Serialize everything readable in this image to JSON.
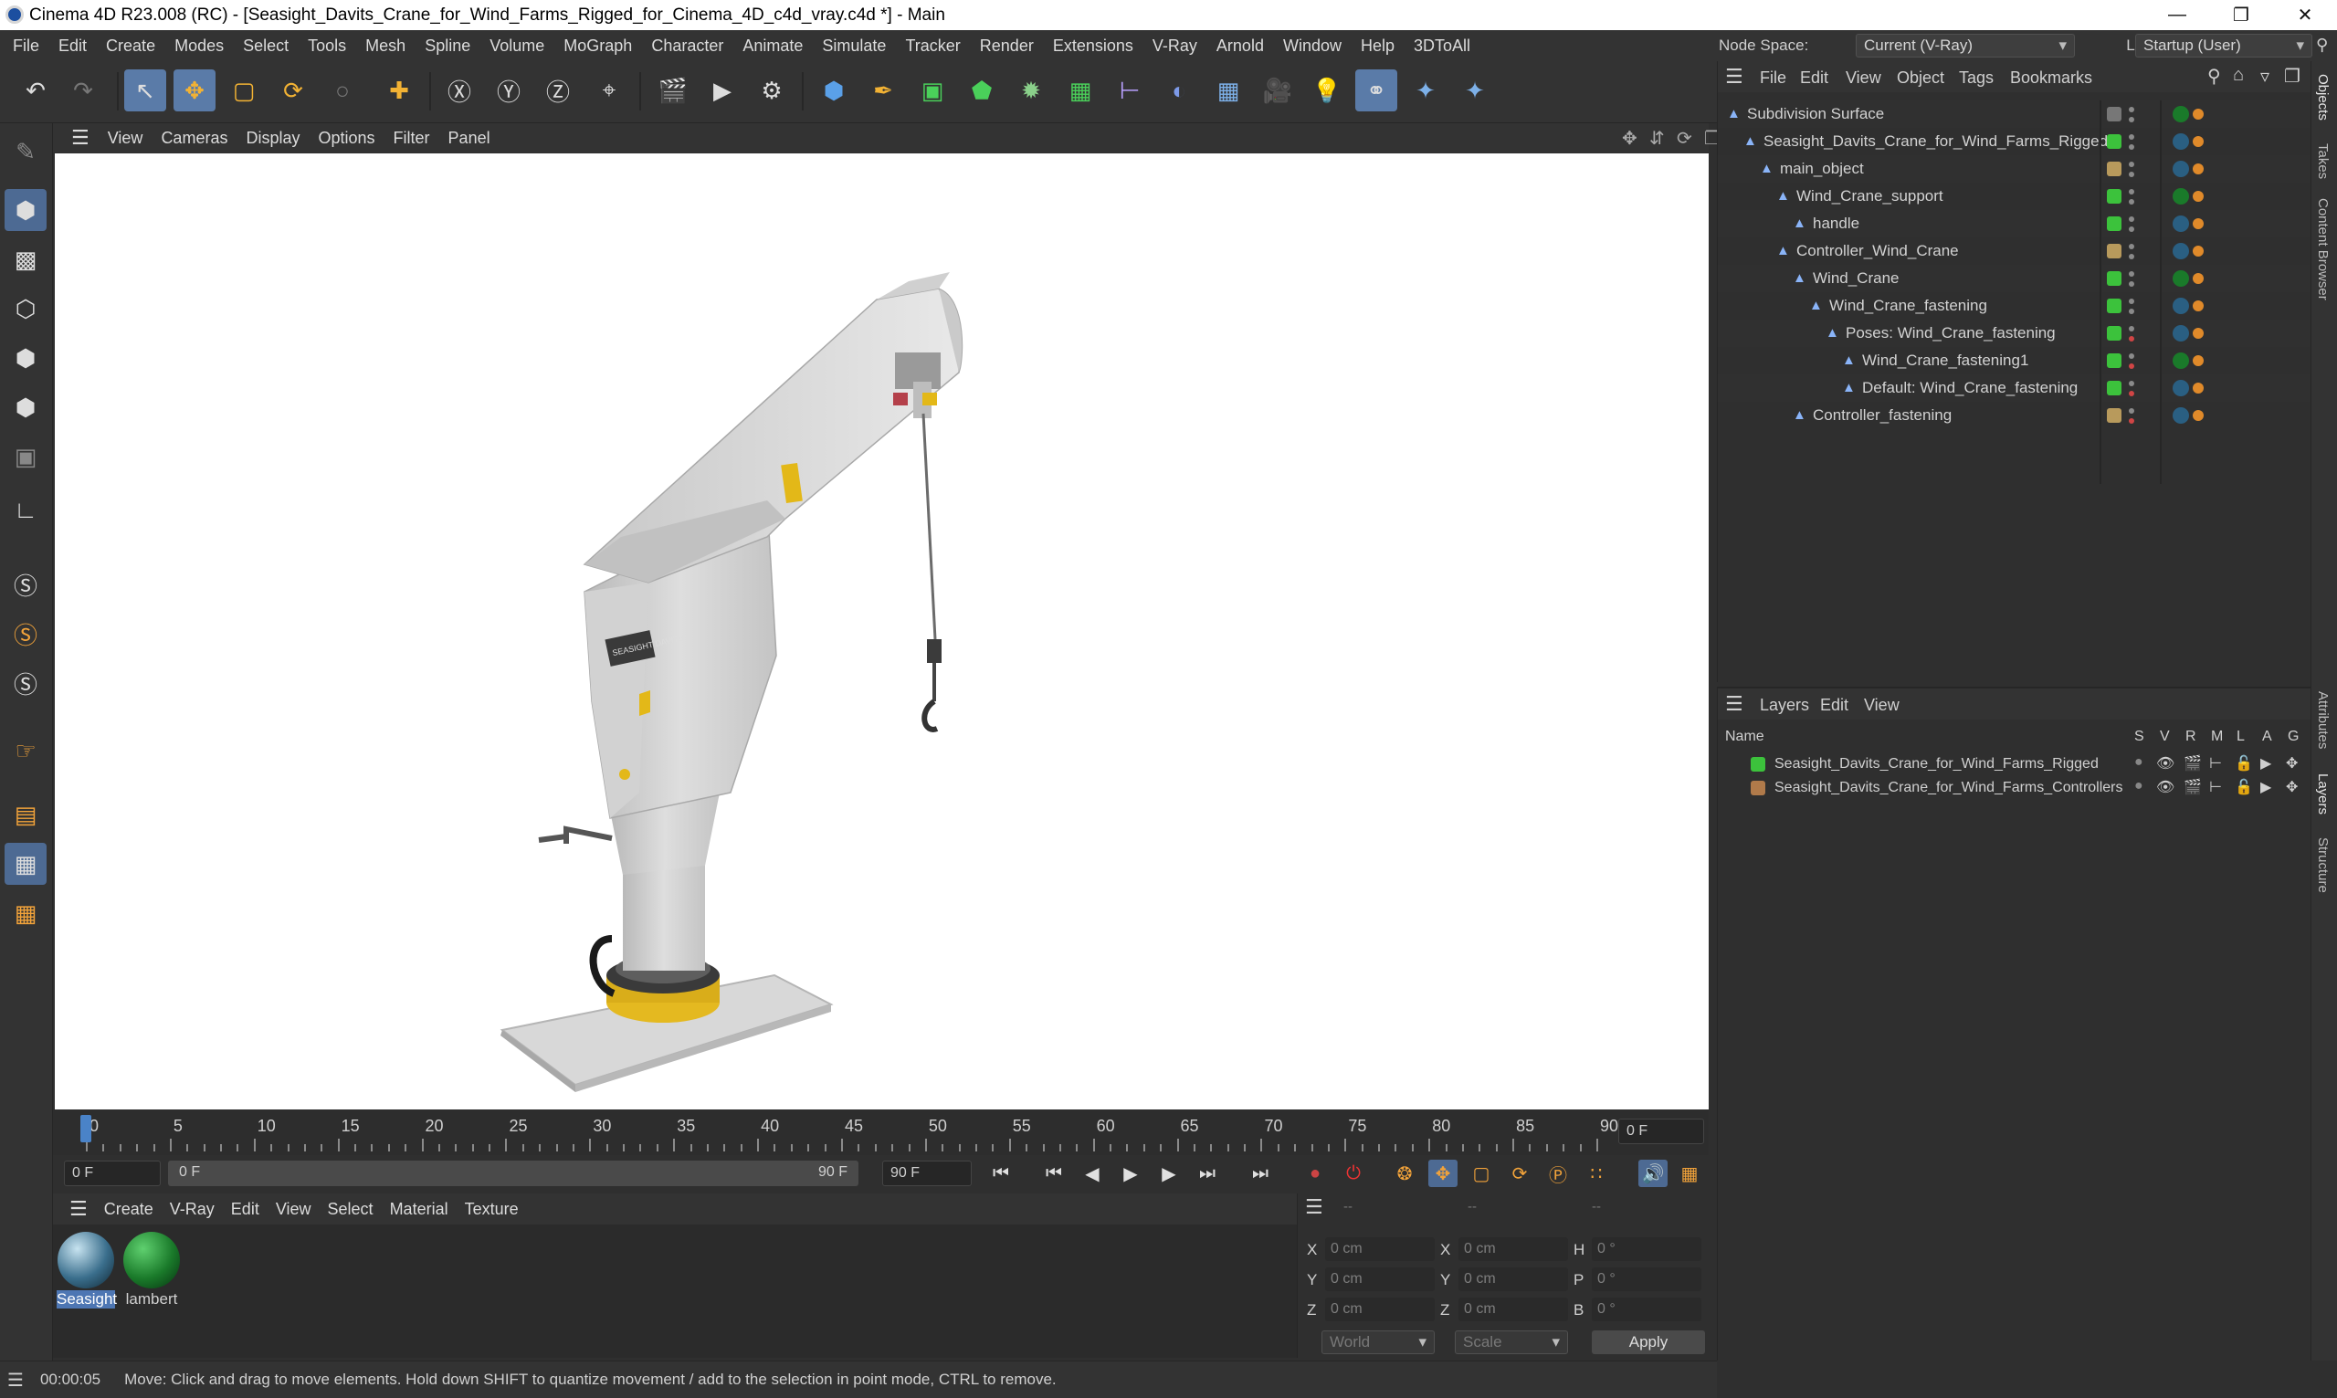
{
  "window": {
    "title": "Cinema 4D R23.008 (RC) - [Seasight_Davits_Crane_for_Wind_Farms_Rigged_for_Cinema_4D_c4d_vray.c4d *] - Main"
  },
  "menu": [
    "File",
    "Edit",
    "Create",
    "Modes",
    "Select",
    "Tools",
    "Mesh",
    "Spline",
    "Volume",
    "MoGraph",
    "Character",
    "Animate",
    "Simulate",
    "Tracker",
    "Render",
    "Extensions",
    "V-Ray",
    "Arnold",
    "Window",
    "Help",
    "3DToAll"
  ],
  "node_space": {
    "label": "Node Space:",
    "value": "Current (V-Ray)",
    "layout_label": "Layout:",
    "layout_value": "Startup (User)"
  },
  "viewport_menu": [
    "View",
    "Cameras",
    "Display",
    "Options",
    "Filter",
    "Panel"
  ],
  "object_manager": {
    "menu": [
      "File",
      "Edit",
      "View",
      "Object",
      "Tags",
      "Bookmarks"
    ],
    "objects": [
      {
        "name": "Subdivision Surface",
        "indent": 0,
        "color": "#777777"
      },
      {
        "name": "Seasight_Davits_Crane_for_Wind_Farms_Rigged",
        "indent": 1,
        "color": "#3cc23c"
      },
      {
        "name": "main_object",
        "indent": 2,
        "color": "#b89a5c"
      },
      {
        "name": "Wind_Crane_support",
        "indent": 3,
        "color": "#3cc23c"
      },
      {
        "name": "handle",
        "indent": 4,
        "color": "#3cc23c"
      },
      {
        "name": "Controller_Wind_Crane",
        "indent": 3,
        "color": "#b89a5c"
      },
      {
        "name": "Wind_Crane",
        "indent": 4,
        "color": "#3cc23c"
      },
      {
        "name": "Wind_Crane_fastening",
        "indent": 5,
        "color": "#3cc23c"
      },
      {
        "name": "Poses: Wind_Crane_fastening",
        "indent": 6,
        "color": "#3cc23c"
      },
      {
        "name": "Wind_Crane_fastening1",
        "indent": 7,
        "color": "#3cc23c"
      },
      {
        "name": "Default: Wind_Crane_fastening",
        "indent": 7,
        "color": "#3cc23c"
      },
      {
        "name": "Controller_fastening",
        "indent": 4,
        "color": "#b89a5c"
      }
    ]
  },
  "layer_manager": {
    "menu": [
      "Layers",
      "Edit",
      "View"
    ],
    "columns": {
      "name": "Name",
      "flags": [
        "S",
        "V",
        "R",
        "M",
        "L",
        "A",
        "G"
      ]
    },
    "layers": [
      {
        "name": "Seasight_Davits_Crane_for_Wind_Farms_Rigged",
        "color": "#3cc23c"
      },
      {
        "name": "Seasight_Davits_Crane_for_Wind_Farms_Controllers",
        "color": "#b07a4a"
      }
    ]
  },
  "right_tabs": [
    "Objects",
    "Takes",
    "Content Browser",
    "Attributes",
    "Layers",
    "Structure"
  ],
  "timeline": {
    "ticks": [
      0,
      5,
      10,
      15,
      20,
      25,
      30,
      35,
      40,
      45,
      50,
      55,
      60,
      65,
      70,
      75,
      80,
      85,
      90
    ],
    "current_frame": "0 F",
    "start": "0 F",
    "range_start": "0 F",
    "range_end": "90 F",
    "end": "90 F"
  },
  "material_manager": {
    "menu": [
      "Create",
      "V-Ray",
      "Edit",
      "View",
      "Select",
      "Material",
      "Texture"
    ],
    "materials": [
      {
        "name": "Seasight",
        "color": "#3a6e8c"
      },
      {
        "name": "lambert",
        "color": "#1a7a2a"
      }
    ]
  },
  "coordinates": {
    "headers": [
      "--",
      "--",
      "--"
    ],
    "rows": [
      {
        "a": "X",
        "av": "0 cm",
        "b": "X",
        "bv": "0 cm",
        "c": "H",
        "cv": "0 °"
      },
      {
        "a": "Y",
        "av": "0 cm",
        "b": "Y",
        "bv": "0 cm",
        "c": "P",
        "cv": "0 °"
      },
      {
        "a": "Z",
        "av": "0 cm",
        "b": "Z",
        "bv": "0 cm",
        "c": "B",
        "cv": "0 °"
      }
    ],
    "world": "World",
    "scale": "Scale",
    "apply": "Apply"
  },
  "status": {
    "time": "00:00:05",
    "message": "Move: Click and drag to move elements. Hold down SHIFT to quantize movement / add to the selection in point mode, CTRL to remove."
  },
  "crane_label": "SEASIGHT DAVITS"
}
